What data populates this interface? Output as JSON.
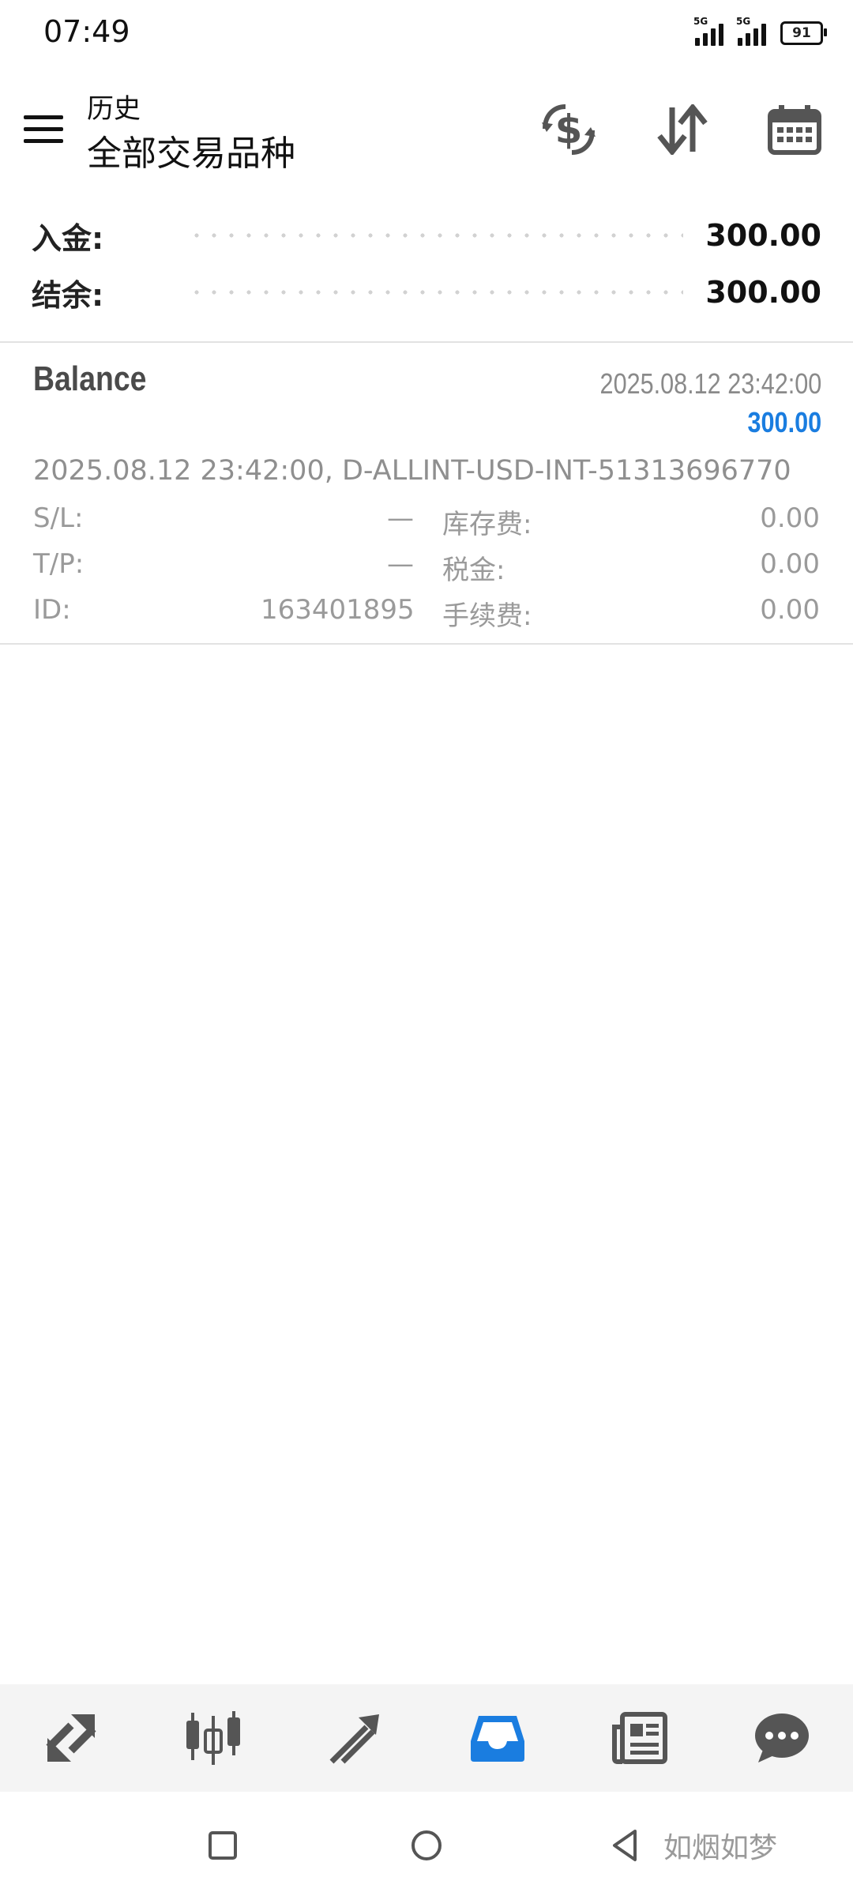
{
  "status_bar": {
    "time": "07:49",
    "signal1_label": "5G",
    "signal2_label": "5G",
    "battery": "91"
  },
  "toolbar": {
    "subtitle": "历史",
    "title": "全部交易品种",
    "icons": [
      "menu-icon",
      "currency-exchange-icon",
      "sort-icon",
      "calendar-icon"
    ]
  },
  "summary": {
    "deposit_label": "入金:",
    "deposit_value": "300.00",
    "balance_label": "结余:",
    "balance_value": "300.00"
  },
  "deal": {
    "type": "Balance",
    "time": "2025.08.12 23:42:00",
    "amount": "300.00",
    "comment": "2025.08.12 23:42:00, D-ALLINT-USD-INT-51313696770",
    "sl_label": "S/L:",
    "sl_value": "—",
    "tp_label": "T/P:",
    "tp_value": "—",
    "id_label": "ID:",
    "id_value": "163401895",
    "swap_label": "库存费:",
    "swap_value": "0.00",
    "tax_label": "税金:",
    "tax_value": "0.00",
    "commission_label": "手续费:",
    "commission_value": "0.00"
  },
  "bottom_nav": {
    "items": [
      "quotes-icon",
      "chart-icon",
      "trade-icon",
      "history-icon",
      "news-icon",
      "chat-icon"
    ],
    "active_color": "#1a7de0",
    "inactive_color": "#555555"
  },
  "system_nav": {
    "items": [
      "recents-button",
      "home-button",
      "back-button"
    ]
  },
  "watermark": "如烟如梦"
}
